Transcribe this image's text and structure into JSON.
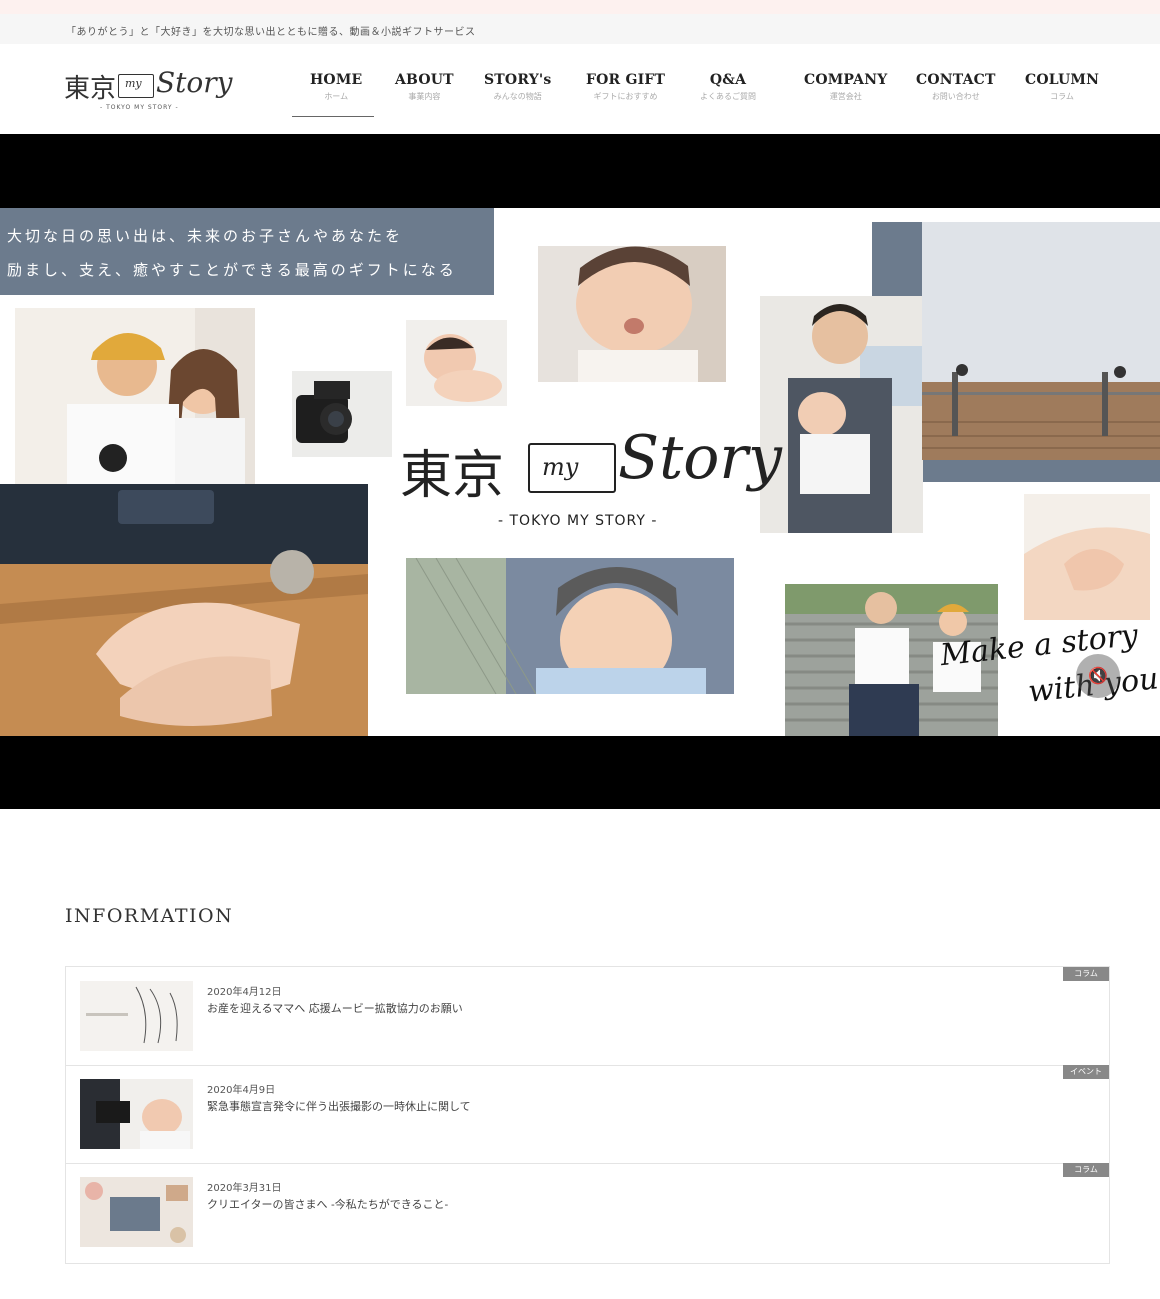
{
  "announcement": "「ありがとう」と「大好き」を大切な思い出とともに贈る、動画＆小説ギフトサービス",
  "logo": {
    "kanji": "東京",
    "book": "my",
    "script": "Story",
    "sub": "- TOKYO MY STORY -"
  },
  "nav": [
    {
      "en": "HOME",
      "ja": "ホーム"
    },
    {
      "en": "ABOUT",
      "ja": "事業内容"
    },
    {
      "en": "STORY's",
      "ja": "みんなの物語"
    },
    {
      "en": "FOR GIFT",
      "ja": "ギフトにおすすめ"
    },
    {
      "en": "Q&A",
      "ja": "よくあるご質問"
    },
    {
      "en": "COMPANY",
      "ja": "運営会社"
    },
    {
      "en": "CONTACT",
      "ja": "お問い合わせ"
    },
    {
      "en": "COLUMN",
      "ja": "コラム"
    }
  ],
  "hero": {
    "tagline_line1": "大切な日の思い出は、未来のお子さんやあなたを",
    "tagline_line2": "励まし、支え、癒やすことができる最高のギフトになる",
    "logo_kanji": "東京",
    "logo_book": "my",
    "logo_script": "Story",
    "logo_sub": "- TOKYO MY STORY -",
    "slogan_line1": "Make a story",
    "slogan_line2": "with you",
    "mute_icon": "🔇"
  },
  "information": {
    "title": "INFORMATION",
    "items": [
      {
        "date": "2020年4月12日",
        "title": "お産を迎えるママへ 応援ムービー拡散協力のお願い",
        "tag": "コラム"
      },
      {
        "date": "2020年4月9日",
        "title": "緊急事態宣言発令に伴う出張撮影の一時休止に関して",
        "tag": "イベント"
      },
      {
        "date": "2020年3月31日",
        "title": "クリエイターの皆さまへ -今私たちができること-",
        "tag": "コラム"
      }
    ]
  },
  "colors": {
    "accent": "#6c7b8d",
    "tag_bg": "#888888",
    "top_strip": "#fdf1ef"
  }
}
